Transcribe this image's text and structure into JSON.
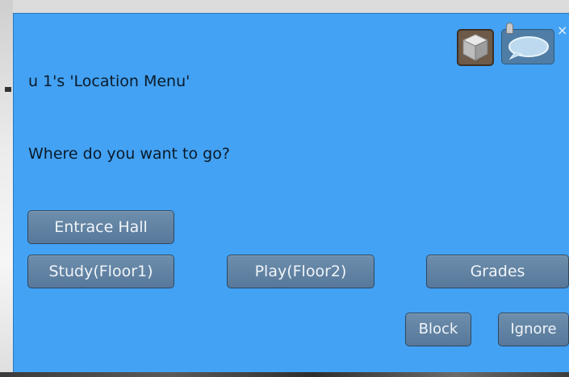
{
  "dialog": {
    "title": "u 1's 'Location Menu'",
    "message": "Where do you want to go?",
    "close_label": "×"
  },
  "icons": {
    "object": "cube-icon",
    "chat": "speech-bubble-icon"
  },
  "buttons": {
    "row1": [
      "Entrace Hall"
    ],
    "row2": [
      "Study(Floor1)",
      "Play(Floor2)",
      "Grades"
    ],
    "actions": [
      "Block",
      "Ignore"
    ]
  },
  "colors": {
    "dialog_bg": "#43a2f3",
    "button_bg": "#6184a6",
    "text": "#0b1a2a"
  }
}
